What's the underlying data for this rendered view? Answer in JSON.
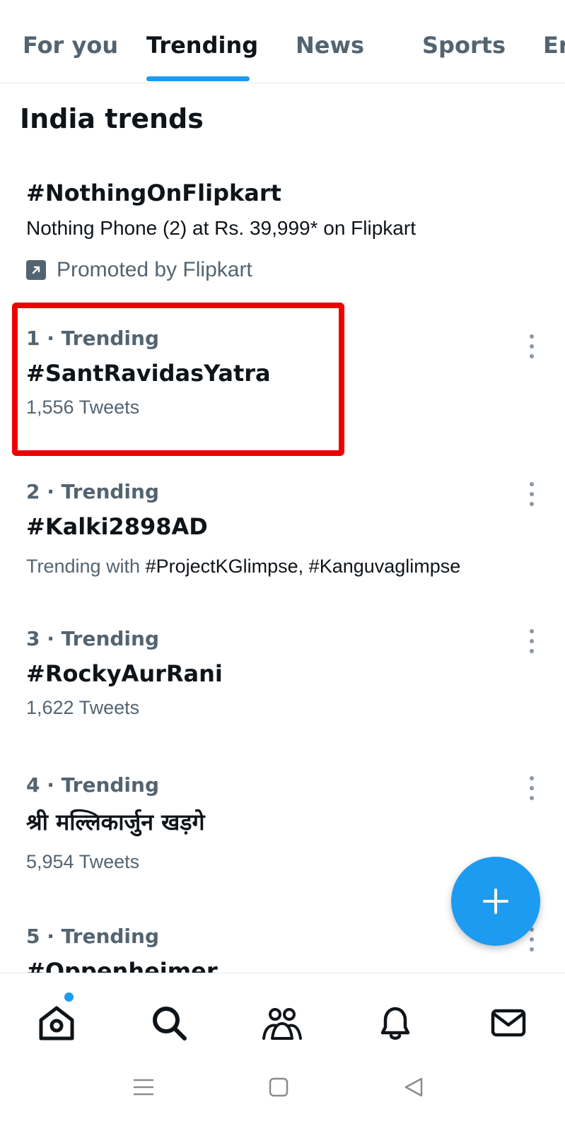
{
  "tabs": [
    {
      "label": "For you"
    },
    {
      "label": "Trending"
    },
    {
      "label": "News"
    },
    {
      "label": "Sports"
    },
    {
      "label": "Er"
    }
  ],
  "section_title": "India trends",
  "promoted": {
    "tag": "#NothingOnFlipkart",
    "description": "Nothing Phone (2) at Rs. 39,999* on Flipkart",
    "promoted_by": "Promoted by Flipkart",
    "icon": "promoted-arrow-icon"
  },
  "trends": [
    {
      "meta": "1 · Trending",
      "name": "#SantRavidasYatra",
      "sub": "1,556 Tweets"
    },
    {
      "meta": "2 · Trending",
      "name": "#Kalki2898AD",
      "sub_prefix": "Trending with ",
      "sub_highlight": "#ProjectKGlimpse, #Kanguvaglimpse"
    },
    {
      "meta": "3 · Trending",
      "name": "#RockyAurRani",
      "sub": "1,622 Tweets"
    },
    {
      "meta": "4 · Trending",
      "name": "श्री मल्लिकार्जुन खड़गे",
      "sub": "5,954 Tweets"
    },
    {
      "meta": "5 · Trending",
      "name": "#Oppenheimer"
    }
  ],
  "colors": {
    "accent": "#1d9bf0",
    "highlight_border": "#ee0000",
    "secondary_text": "#536471"
  },
  "bottom_nav": {
    "items": [
      "home-icon",
      "search-icon",
      "communities-icon",
      "notifications-icon",
      "messages-icon"
    ],
    "home_has_badge": true
  },
  "system_nav": [
    "recents-icon",
    "home-square-icon",
    "back-icon"
  ]
}
